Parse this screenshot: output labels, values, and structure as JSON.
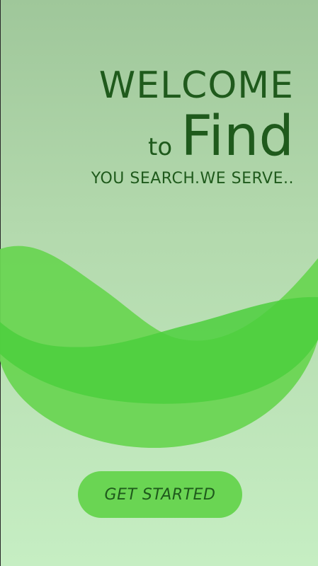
{
  "splash": {
    "title_line1": "WELCOME",
    "title_to": "to",
    "title_find": "Find",
    "tagline": "YOU SEARCH.WE SERVE..",
    "cta_label": "GET STARTED"
  },
  "colors": {
    "text": "#1f5a1c",
    "accent": "#6ad553",
    "wave_light": "#6ad553",
    "wave_mid": "#4ccf3d",
    "bg_top": "#9fc79a",
    "bg_bottom": "#c6eec3"
  }
}
